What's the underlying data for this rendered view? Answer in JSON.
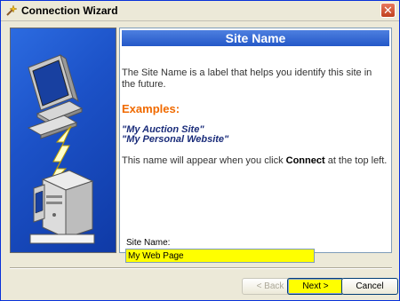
{
  "window": {
    "title": "Connection Wizard"
  },
  "header": {
    "title": "Site Name"
  },
  "content": {
    "description": "The Site Name is a label that helps you identify this site in the future.",
    "examples_heading": "Examples:",
    "examples": [
      "\"My Auction Site\"",
      "\"My Personal Website\""
    ],
    "note_prefix": "This name will appear when you click ",
    "note_bold": "Connect",
    "note_suffix": " at the top left."
  },
  "form": {
    "site_name_label": "Site Name:",
    "site_name_value": "My Web Page"
  },
  "buttons": {
    "back": "< Back",
    "next": "Next >",
    "cancel": "Cancel"
  },
  "colors": {
    "header": "#2458c8",
    "accent_orange": "#f06a00",
    "highlight_yellow": "#ffff00"
  },
  "icons": {
    "title": "wizard-icon",
    "close": "close-icon",
    "illustration": "computer-server-connection-icon"
  }
}
